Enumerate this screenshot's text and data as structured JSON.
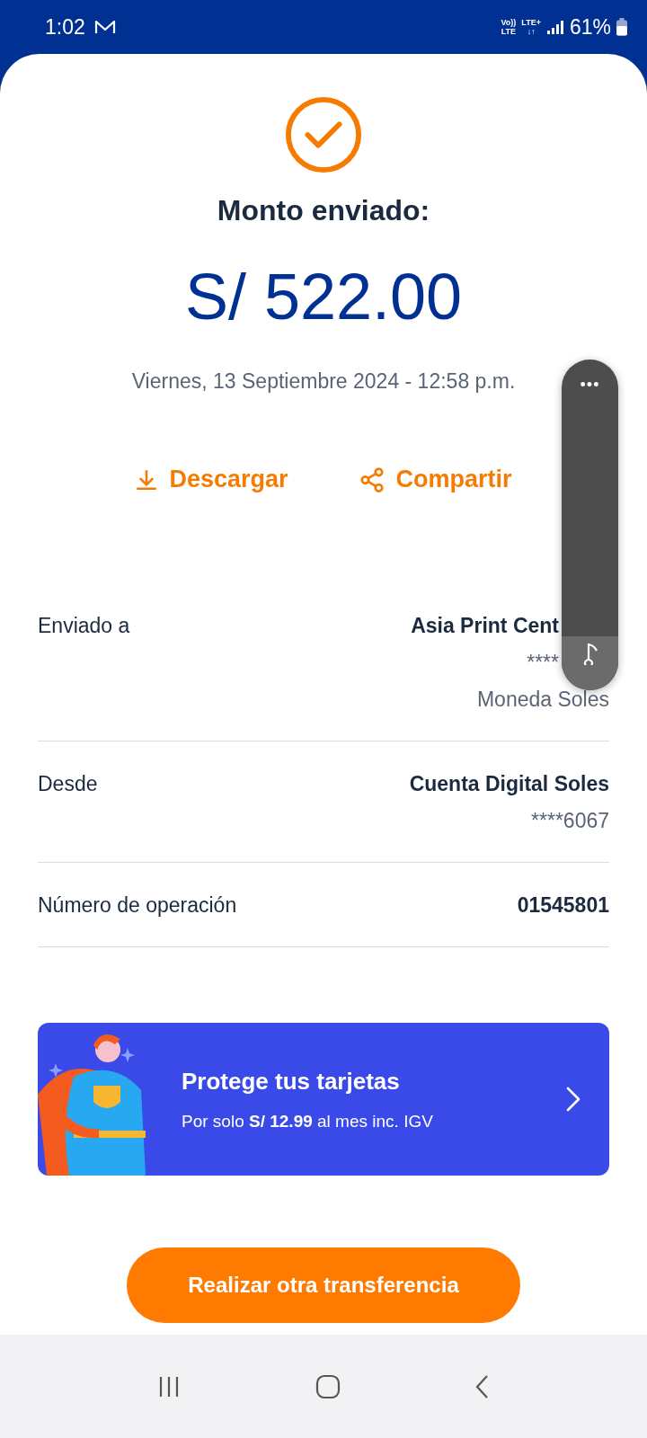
{
  "status_bar": {
    "time": "1:02",
    "network_top": "Vo))",
    "network_bottom": "LTE",
    "data_top": "LTE+",
    "data_bottom": "↓↑",
    "battery": "61%"
  },
  "title": "Monto enviado:",
  "amount": "S/ 522.00",
  "datetime": "Viernes, 13 Septiembre 2024 - 12:58 p.m.",
  "actions": [
    {
      "kind": "download",
      "label": "Descargar"
    },
    {
      "kind": "share",
      "label": "Compartir"
    }
  ],
  "details": [
    {
      "label": "Enviado a",
      "lines": [
        "Asia Print Cent",
        "****",
        "Moneda Soles"
      ]
    },
    {
      "label": "Desde",
      "lines": [
        "Cuenta Digital Soles",
        "****6067"
      ]
    },
    {
      "label": "Número de operación",
      "lines": [
        "01545801"
      ]
    }
  ],
  "banner": {
    "title": "Protege tus tarjetas",
    "subtitle": "Por solo **S/ 12.99** al mes inc. IGV"
  },
  "primary_button": "Realizar otra transferencia",
  "floating_panel": {
    "menu": "•••"
  }
}
